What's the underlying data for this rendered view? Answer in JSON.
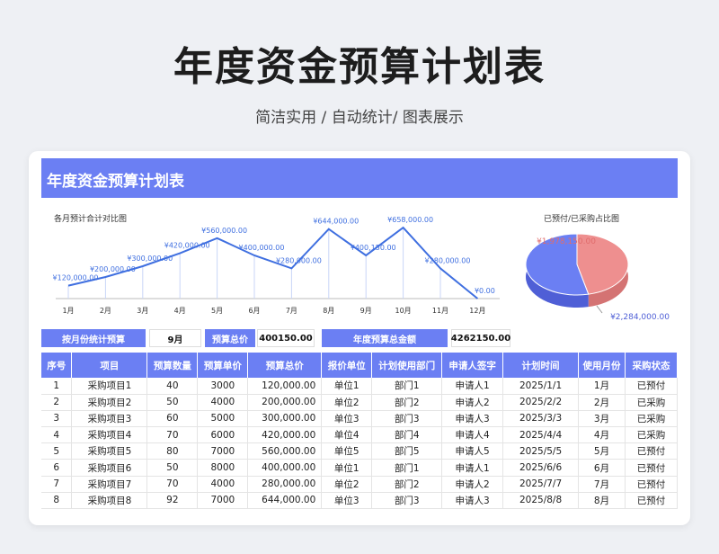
{
  "page": {
    "title": "年度资金预算计划表",
    "subtitle": "简洁实用 / 自动统计/ 图表展示"
  },
  "sheet": {
    "header": "年度资金预算计划表",
    "line_chart_title": "各月预计合计对比图",
    "pie_chart_title": "已预付/已采购占比图"
  },
  "chart_data": [
    {
      "type": "line",
      "title": "各月预计合计对比图",
      "categories": [
        "1月",
        "2月",
        "3月",
        "4月",
        "5月",
        "6月",
        "7月",
        "8月",
        "9月",
        "10月",
        "11月",
        "12月"
      ],
      "values": [
        120000,
        200000,
        300000,
        420000,
        560000,
        400000,
        280000,
        644000,
        400150,
        658000,
        280000,
        0
      ],
      "data_labels": [
        "¥120,000.00",
        "¥200,000.00",
        "¥300,000.00",
        "¥420,000.00",
        "¥560,000.00",
        "¥400,000.00",
        "¥280,000.00",
        "¥644,000.00",
        "¥400,150.00",
        "¥658,000.00",
        "¥280,000.00",
        "¥0.00"
      ],
      "ylim": [
        0,
        700000
      ],
      "color": "#3f6fe0"
    },
    {
      "type": "pie",
      "title": "已预付/已采购占比图",
      "slices": [
        {
          "label": "¥1,978,150.00",
          "value": 1978150,
          "color": "#ee8f8f"
        },
        {
          "label": "¥2,284,000.00",
          "value": 2284000,
          "color": "#6b7ff3"
        }
      ]
    }
  ],
  "summary": {
    "by_month_label": "按月份统计预算",
    "month_value": "9月",
    "budget_total_label": "预算总价",
    "budget_total_value": "400150.00",
    "annual_label": "年度预算总金额",
    "annual_value": "4262150.00"
  },
  "table": {
    "headers": [
      "序号",
      "项目",
      "预算数量",
      "预算单价",
      "预算总价",
      "报价单位",
      "计划使用部门",
      "申请人签字",
      "计划时间",
      "使用月份",
      "采购状态"
    ],
    "rows": [
      [
        "1",
        "采购项目1",
        "40",
        "3000",
        "120,000.00",
        "单位1",
        "部门1",
        "申请人1",
        "2025/1/1",
        "1月",
        "已预付"
      ],
      [
        "2",
        "采购项目2",
        "50",
        "4000",
        "200,000.00",
        "单位2",
        "部门2",
        "申请人2",
        "2025/2/2",
        "2月",
        "已采购"
      ],
      [
        "3",
        "采购项目3",
        "60",
        "5000",
        "300,000.00",
        "单位3",
        "部门3",
        "申请人3",
        "2025/3/3",
        "3月",
        "已采购"
      ],
      [
        "4",
        "采购项目4",
        "70",
        "6000",
        "420,000.00",
        "单位4",
        "部门4",
        "申请人4",
        "2025/4/4",
        "4月",
        "已采购"
      ],
      [
        "5",
        "采购项目5",
        "80",
        "7000",
        "560,000.00",
        "单位5",
        "部门5",
        "申请人5",
        "2025/5/5",
        "5月",
        "已预付"
      ],
      [
        "6",
        "采购项目6",
        "50",
        "8000",
        "400,000.00",
        "单位1",
        "部门1",
        "申请人1",
        "2025/6/6",
        "6月",
        "已预付"
      ],
      [
        "7",
        "采购项目7",
        "70",
        "4000",
        "280,000.00",
        "单位2",
        "部门2",
        "申请人2",
        "2025/7/7",
        "7月",
        "已预付"
      ],
      [
        "8",
        "采购项目8",
        "92",
        "7000",
        "644,000.00",
        "单位3",
        "部门3",
        "申请人3",
        "2025/8/8",
        "8月",
        "已预付"
      ]
    ]
  }
}
